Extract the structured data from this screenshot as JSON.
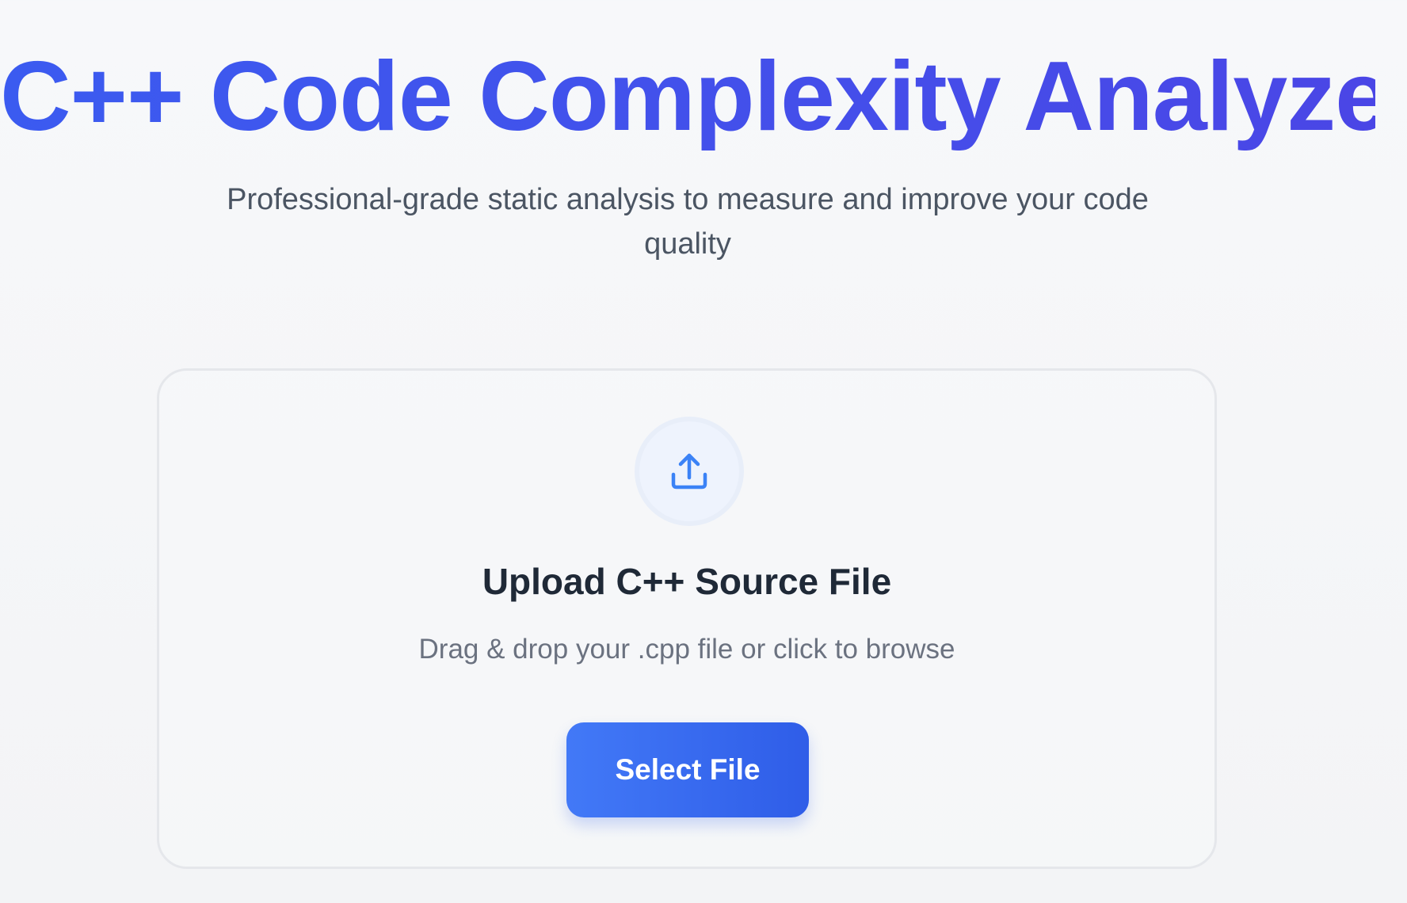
{
  "header": {
    "title": "C++ Code Complexity Analyzer",
    "subtitle": "Professional-grade static analysis to measure and improve your code quality"
  },
  "upload": {
    "icon": "upload-icon",
    "title": "Upload C++ Source File",
    "description": "Drag & drop your .cpp file or click to browse",
    "button_label": "Select File"
  },
  "colors": {
    "accent": "#3b5bf0",
    "button": "#3b6af2",
    "icon": "#3b82f6"
  }
}
